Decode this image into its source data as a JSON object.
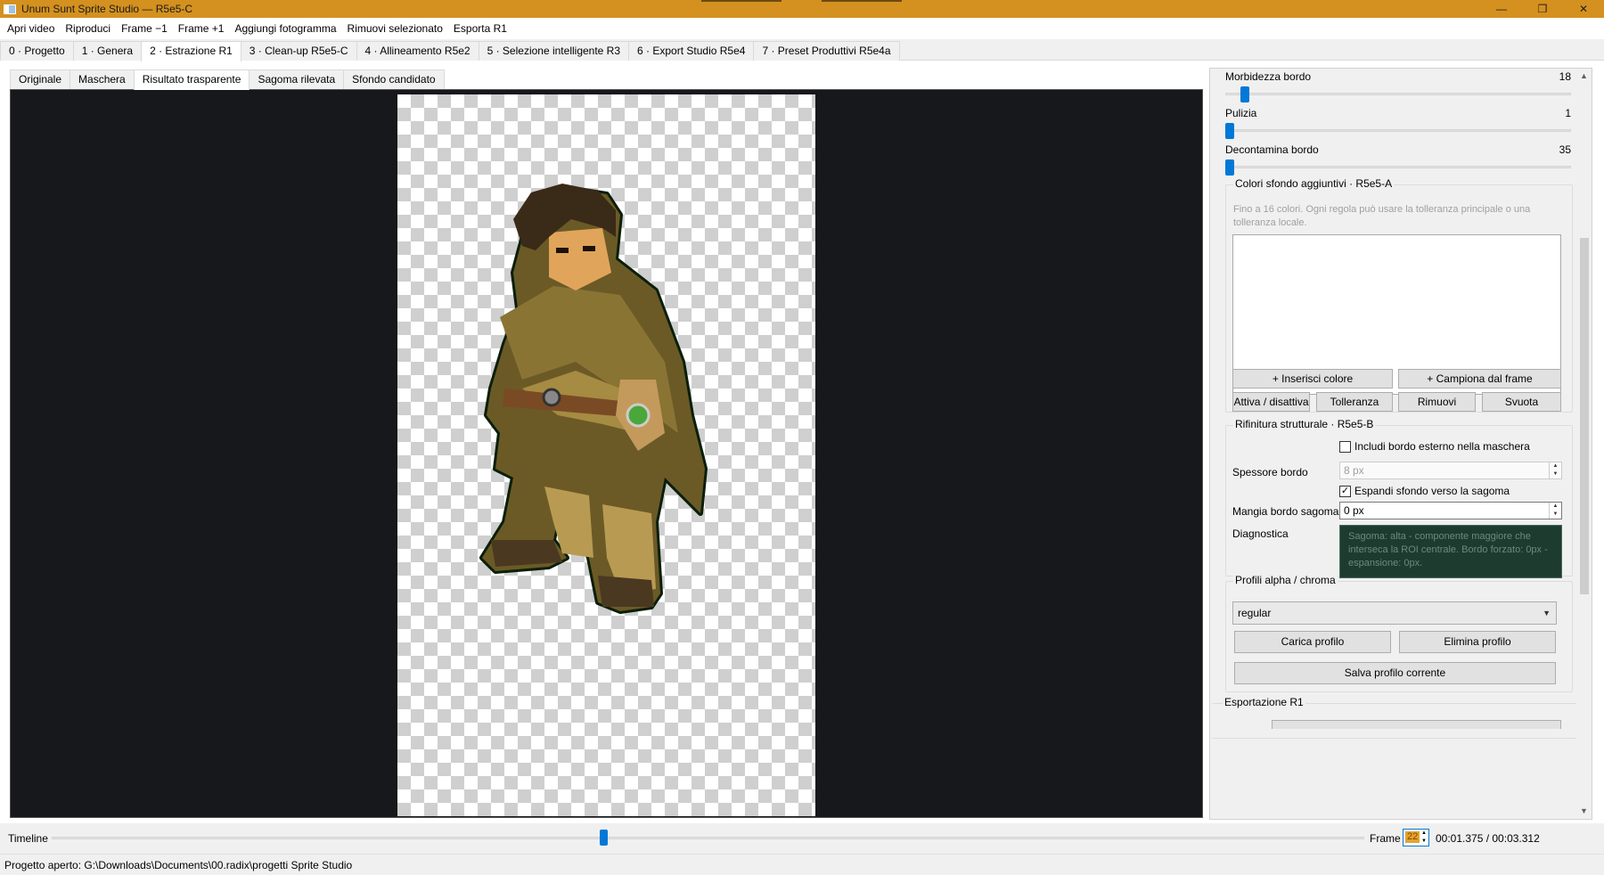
{
  "window": {
    "title": "Unum Sunt Sprite Studio — R5e5-C",
    "controls": [
      "—",
      "❐",
      "✕"
    ]
  },
  "menu": {
    "items": [
      "Apri video",
      "Riproduci",
      "Frame −1",
      "Frame +1",
      "Aggiungi fotogramma",
      "Rimuovi selezionato",
      "Esporta R1"
    ]
  },
  "main_tabs": {
    "items": [
      "0 · Progetto",
      "1 · Genera",
      "2 · Estrazione R1",
      "3 · Clean-up R5e5-C",
      "4 · Allineamento R5e2",
      "5 · Selezione intelligente R3",
      "6 · Export Studio R5e4",
      "7 · Preset Produttivi R5e4a"
    ],
    "active_index": 2
  },
  "view_tabs": {
    "items": [
      "Originale",
      "Maschera",
      "Risultato trasparente",
      "Sagoma rilevata",
      "Sfondo candidato"
    ],
    "active_index": 2
  },
  "settings": {
    "sliders": [
      {
        "label": "Morbidezza bordo",
        "value": "18",
        "fraction": 0.045
      },
      {
        "label": "Pulizia",
        "value": "1",
        "fraction": 0.0
      },
      {
        "label": "Decontamina bordo",
        "value": "35",
        "fraction": 0.0
      }
    ],
    "extra_colors": {
      "title": "Colori sfondo aggiuntivi · R5e5-A",
      "hint": "Fino a 16 colori. Ogni regola può usare la tolleranza principale o una tolleranza locale.",
      "insert_button": "+ Inserisci colore",
      "sample_button": "+ Campiona dal frame",
      "toggle_button": "Attiva / disattiva",
      "tolerance_button": "Tolleranza",
      "remove_button": "Rimuovi",
      "clear_button": "Svuota"
    },
    "structural": {
      "title": "Rifinitura strutturale · R5e5-B",
      "include_border_label": "Includi bordo esterno nella maschera",
      "include_border_checked": false,
      "thickness_label": "Spessore bordo",
      "thickness_value": "8 px",
      "expand_label": "Espandi sfondo verso la sagoma",
      "expand_checked": true,
      "eat_label": "Mangia bordo sagoma",
      "eat_value": "0 px",
      "diag_label": "Diagnostica",
      "diag_text": "Sagoma: alta - componente maggiore che interseca la ROI centrale. Bordo forzato: 0px - espansione: 0px."
    },
    "profiles": {
      "title": "Profili alpha / chroma",
      "selected": "regular",
      "load_button": "Carica profilo",
      "delete_button": "Elimina profilo",
      "save_button": "Salva profilo corrente"
    },
    "export_title": "Esportazione R1"
  },
  "timeline": {
    "label": "Timeline",
    "position_fraction": 0.42,
    "frame_label": "Frame",
    "frame_value": "22",
    "time_text": "00:01.375 / 00:03.312"
  },
  "status": {
    "text": "Progetto aperto: G:\\Downloads\\Documents\\00.radix\\progetti Sprite Studio"
  },
  "colors": {
    "titlebar": "#d4911f",
    "accent": "#0078d7",
    "viewport": "#17181c",
    "diagnostic": "#1e3b30"
  }
}
